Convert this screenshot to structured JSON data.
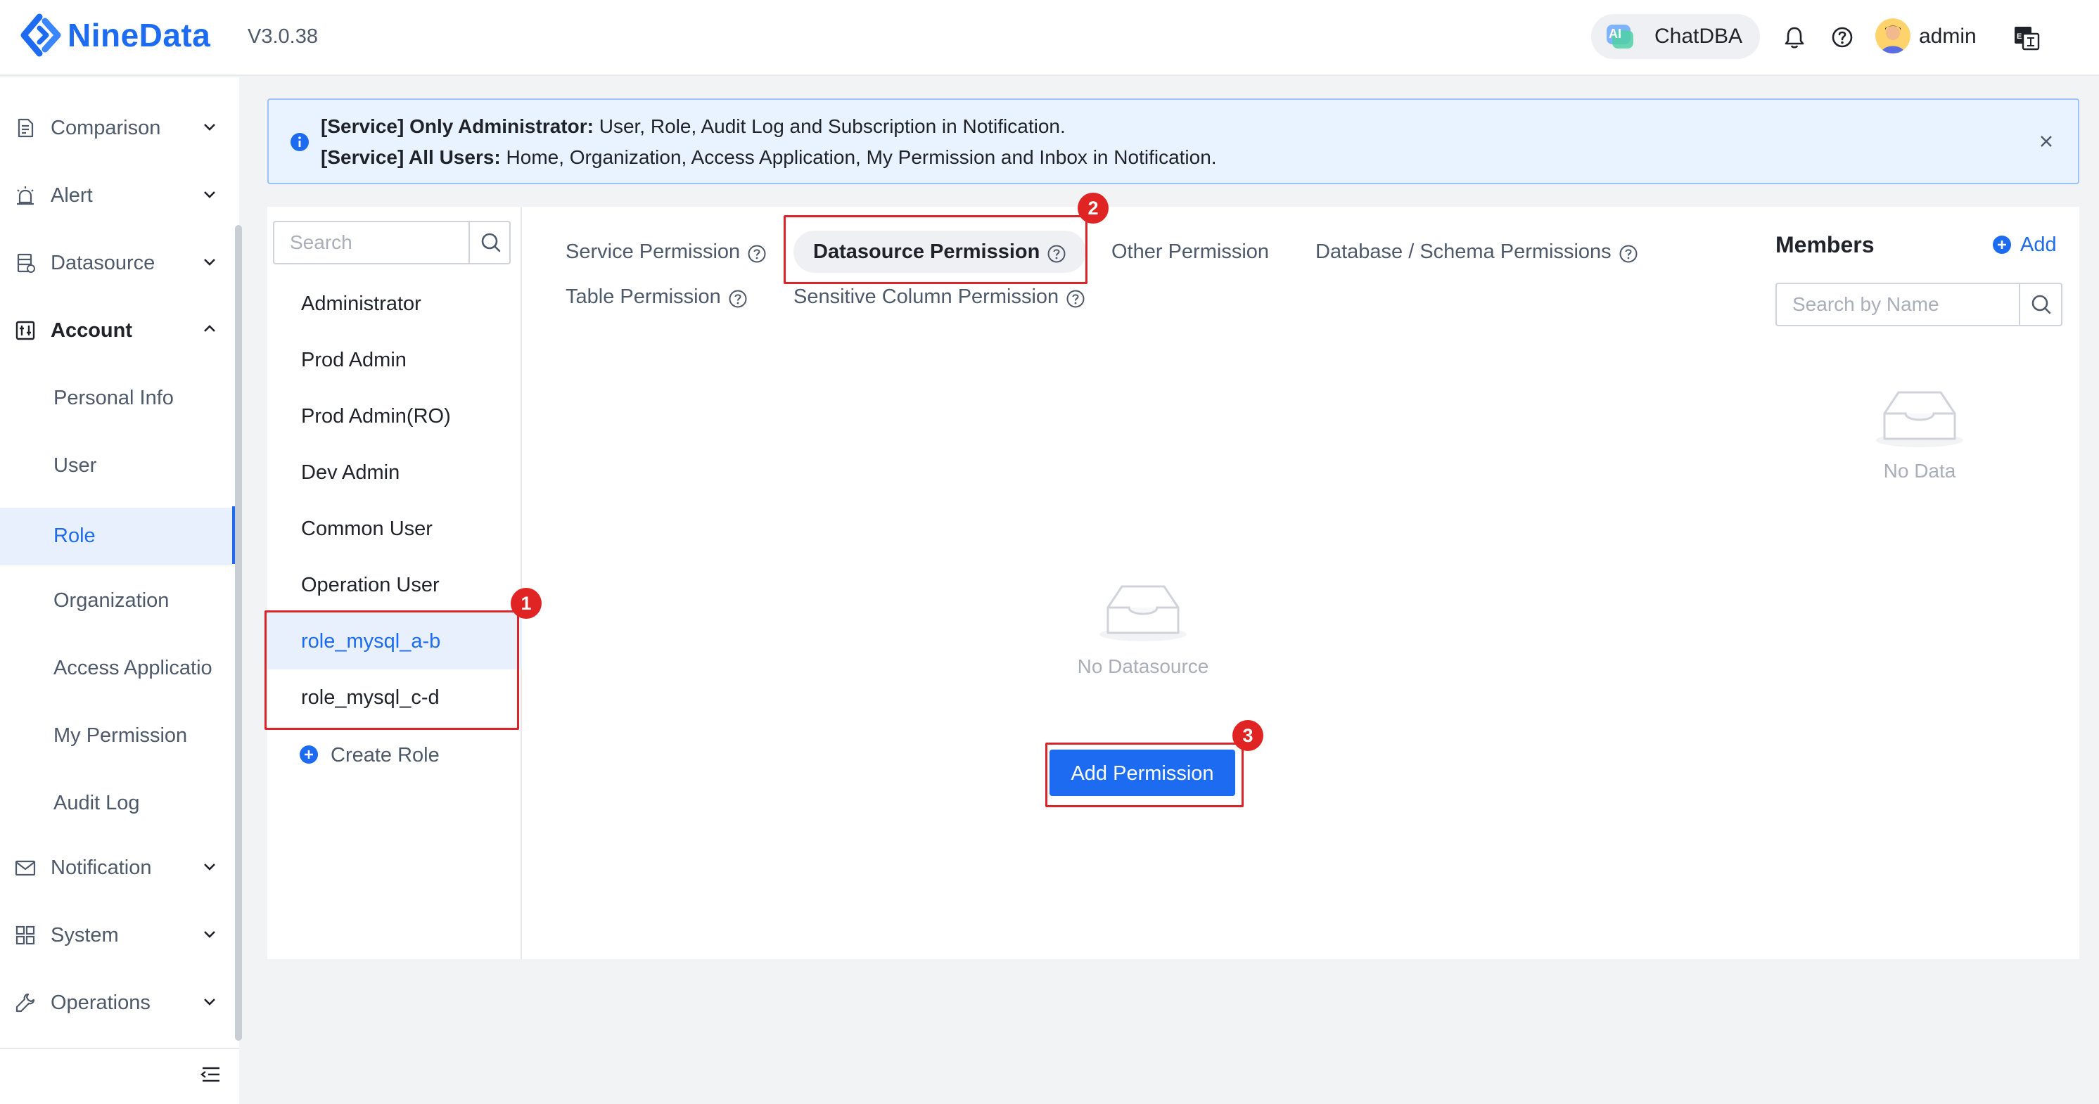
{
  "header": {
    "logo_text": "NineData",
    "version": "V3.0.38",
    "chatdba_label": "ChatDBA",
    "chatdba_icon_text": "AI",
    "username": "admin"
  },
  "sidebar": {
    "items": [
      {
        "label": "Comparison",
        "icon": "document-compare-icon",
        "expanded": false
      },
      {
        "label": "Alert",
        "icon": "alarm-icon",
        "expanded": false
      },
      {
        "label": "Datasource",
        "icon": "datasource-icon",
        "expanded": false
      },
      {
        "label": "Account",
        "icon": "account-icon",
        "expanded": true
      },
      {
        "label": "Notification",
        "icon": "mail-icon",
        "expanded": false
      },
      {
        "label": "System",
        "icon": "grid-icon",
        "expanded": false
      },
      {
        "label": "Operations",
        "icon": "wrench-icon",
        "expanded": false
      }
    ],
    "account_sub": [
      {
        "label": "Personal Info"
      },
      {
        "label": "User"
      },
      {
        "label": "Role",
        "selected": true
      },
      {
        "label": "Organization"
      },
      {
        "label": "Access Applicatio"
      },
      {
        "label": "My Permission"
      },
      {
        "label": "Audit Log"
      }
    ]
  },
  "notice": {
    "line1_bold": "[Service] Only Administrator:",
    "line1_text": " User, Role, Audit Log and Subscription in Notification.",
    "line2_bold": "[Service] All Users:",
    "line2_text": " Home, Organization, Access Application, My Permission and Inbox in Notification."
  },
  "roles": {
    "search_placeholder": "Search",
    "items": [
      {
        "label": "Administrator"
      },
      {
        "label": "Prod Admin"
      },
      {
        "label": "Prod Admin(RO)"
      },
      {
        "label": "Dev Admin"
      },
      {
        "label": "Common User"
      },
      {
        "label": "Operation User"
      },
      {
        "label": "role_mysql_a-b",
        "selected": true
      },
      {
        "label": "role_mysql_c-d"
      }
    ],
    "create_label": "Create Role"
  },
  "tabs": [
    {
      "label": "Service Permission",
      "help": true
    },
    {
      "label": "Datasource Permission",
      "help": true,
      "active": true
    },
    {
      "label": "Other Permission",
      "help": false
    },
    {
      "label": "Database / Schema Permissions",
      "help": true
    },
    {
      "label": "Table Permission",
      "help": true
    },
    {
      "label": "Sensitive Column Permission",
      "help": true
    }
  ],
  "main": {
    "empty_label": "No Datasource",
    "add_permission_label": "Add Permission"
  },
  "members": {
    "title": "Members",
    "add_label": "Add",
    "search_placeholder": "Search by Name",
    "empty_label": "No Data"
  },
  "annotations": [
    "1",
    "2",
    "3"
  ],
  "colors": {
    "accent": "#1c6bf0",
    "highlight": "#d9252a",
    "notice_bg": "#e8f3ff"
  }
}
